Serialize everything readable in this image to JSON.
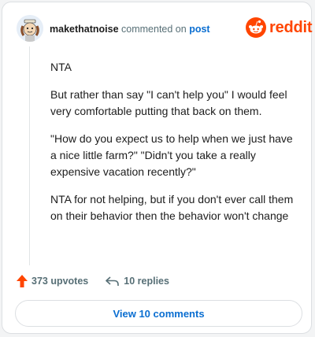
{
  "header": {
    "username": "makethatnoise",
    "action": "commented on",
    "post_link": "post"
  },
  "brand": {
    "logo_word": "reddit",
    "accent": "#ff4500"
  },
  "comment": {
    "paragraphs": [
      "NTA",
      "But rather than say \"I can't help you\" I would feel very comfortable putting that back on them.",
      "\"How do you expect us to help when we just have a nice little farm?\" \"Didn't you take a really expensive vacation recently?\"",
      "NTA for not helping, but if you don't ever call them on their behavior then the behavior won't change"
    ]
  },
  "actions": {
    "upvotes": "373 upvotes",
    "replies": "10 replies",
    "upvote_color": "#ff4500"
  },
  "footer": {
    "view_comments": "View 10 comments",
    "link_color": "#0a6ed1"
  }
}
